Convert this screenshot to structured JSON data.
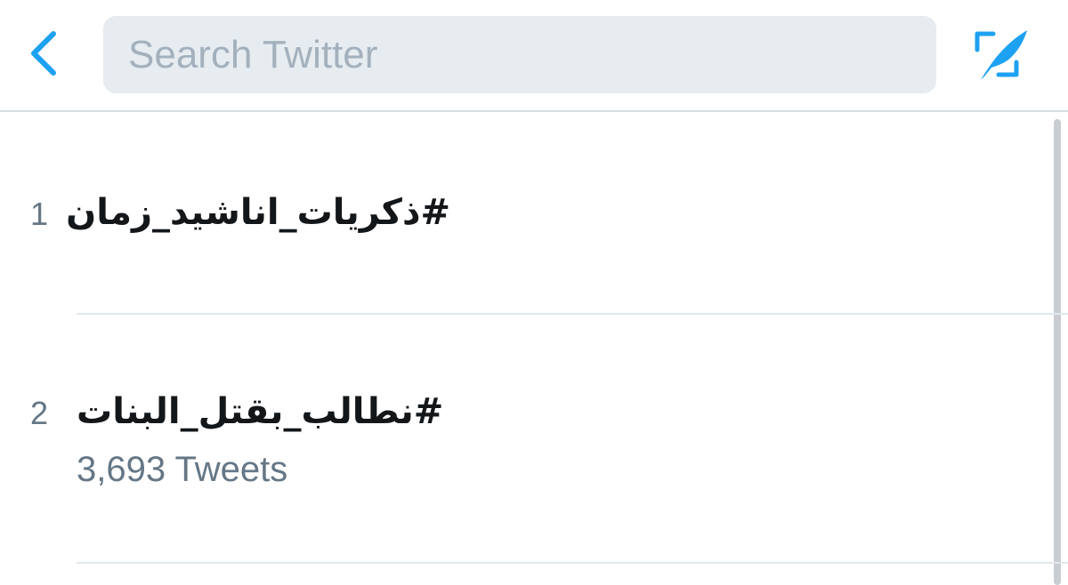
{
  "header": {
    "back_icon": "chevron-left-icon",
    "search_placeholder": "Search Twitter",
    "compose_icon": "compose-tweet-icon",
    "accent_color": "#1da1f2"
  },
  "trends": [
    {
      "rank": "1",
      "name": "#ذكريات_اناشيد_زمان",
      "tweet_count": ""
    },
    {
      "rank": "2",
      "name": "#نطالب_بقتل_البنات",
      "tweet_count": "3,693 Tweets"
    }
  ]
}
